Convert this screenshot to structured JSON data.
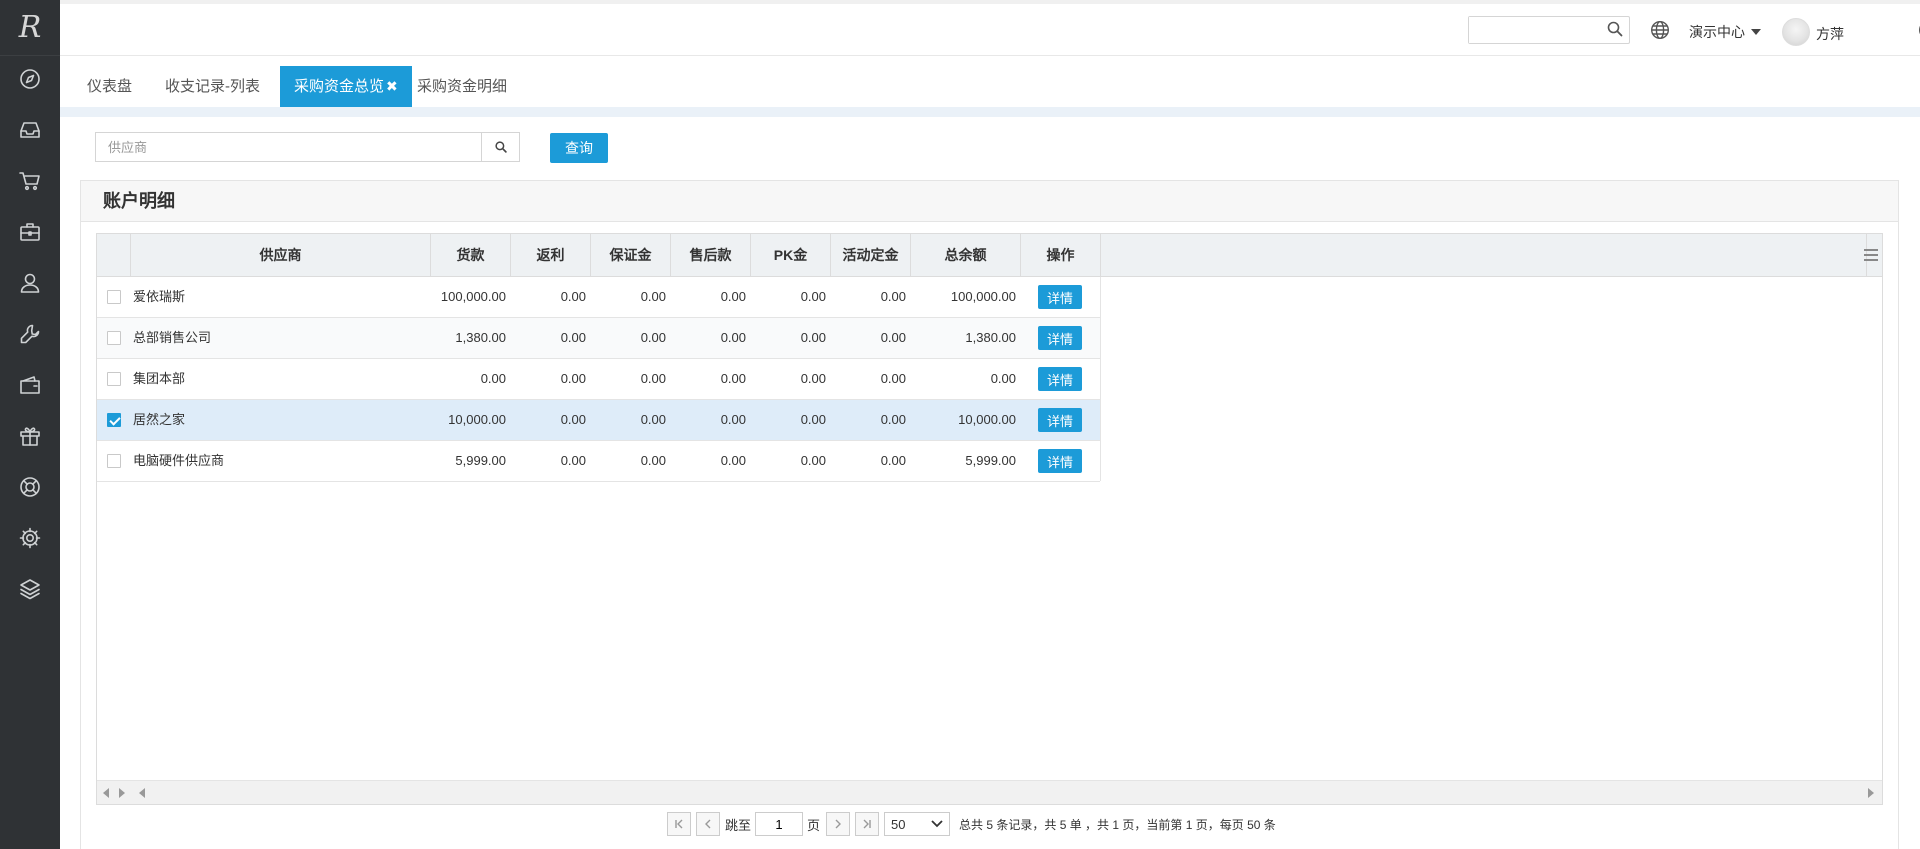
{
  "sidebar": {
    "logo": "R",
    "icons": [
      "compass-icon",
      "inbox-icon",
      "cart-icon",
      "briefcase-icon",
      "user-icon",
      "wrench-icon",
      "wallet-icon",
      "gift-icon",
      "lifebuoy-icon",
      "gear-icon",
      "layers-icon"
    ]
  },
  "header": {
    "search_placeholder": "",
    "center_label": "演示中心",
    "user_name": "方萍"
  },
  "tabs": [
    {
      "label": "仪表盘"
    },
    {
      "label": "收支记录-列表"
    },
    {
      "label": "采购资金总览",
      "active": true,
      "close": "✖"
    },
    {
      "label": "采购资金明细"
    }
  ],
  "filter": {
    "supplier_placeholder": "供应商",
    "query_label": "查询"
  },
  "card": {
    "title": "账户明细"
  },
  "table": {
    "columns": [
      "供应商",
      "货款",
      "返利",
      "保证金",
      "售后款",
      "PK金",
      "活动定金",
      "总余额",
      "操作"
    ],
    "detail_label": "详情",
    "rows": [
      {
        "supplier": "爱依瑞斯",
        "goods": "100,000.00",
        "rebate": "0.00",
        "deposit": "0.00",
        "aftersale": "0.00",
        "pk": "0.00",
        "activity": "0.00",
        "total": "100,000.00",
        "checked": false
      },
      {
        "supplier": "总部销售公司",
        "goods": "1,380.00",
        "rebate": "0.00",
        "deposit": "0.00",
        "aftersale": "0.00",
        "pk": "0.00",
        "activity": "0.00",
        "total": "1,380.00",
        "checked": false
      },
      {
        "supplier": "集团本部",
        "goods": "0.00",
        "rebate": "0.00",
        "deposit": "0.00",
        "aftersale": "0.00",
        "pk": "0.00",
        "activity": "0.00",
        "total": "0.00",
        "checked": false
      },
      {
        "supplier": "居然之家",
        "goods": "10,000.00",
        "rebate": "0.00",
        "deposit": "0.00",
        "aftersale": "0.00",
        "pk": "0.00",
        "activity": "0.00",
        "total": "10,000.00",
        "checked": true
      },
      {
        "supplier": "电脑硬件供应商",
        "goods": "5,999.00",
        "rebate": "0.00",
        "deposit": "0.00",
        "aftersale": "0.00",
        "pk": "0.00",
        "activity": "0.00",
        "total": "5,999.00",
        "checked": false
      }
    ]
  },
  "pager": {
    "jump_label": "跳至",
    "page_value": "1",
    "page_unit": "页",
    "page_size": "50",
    "info": "总共 5 条记录，共 5 单 ，共 1 页，当前第 1 页，每页 50 条"
  },
  "colors": {
    "accent": "#1c9bd8",
    "sidebar_bg": "#2f3235",
    "selected_row": "#deecf9"
  }
}
